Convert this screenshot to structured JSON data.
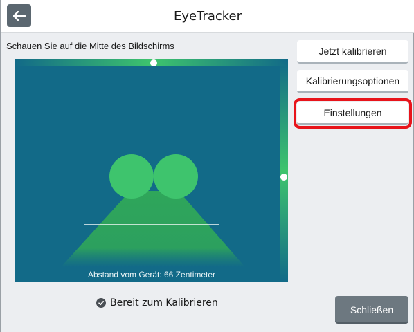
{
  "window": {
    "title": "EyeTracker",
    "back_icon": "arrow-left-icon"
  },
  "instruction": "Schauen Sie auf die Mitte des Bildschirms",
  "tracker": {
    "distance_label": "Abstand vom Gerät: 66 Zentimeter",
    "colors": {
      "background": "#126a88",
      "eyes": "#3ec46d",
      "cone": "#2fa65a"
    }
  },
  "buttons": {
    "calibrate_now": "Jetzt kalibrieren",
    "calibration_options": "Kalibrierungsoptionen",
    "settings": "Einstellungen",
    "close": "Schließen"
  },
  "status": {
    "icon": "check-circle-icon",
    "text": "Bereit zum Kalibrieren"
  },
  "highlight_color": "#e8141b"
}
